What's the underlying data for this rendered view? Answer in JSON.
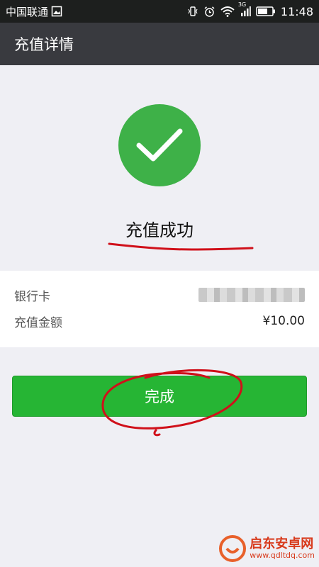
{
  "statusbar": {
    "carrier": "中国联通",
    "network_tag": "3G",
    "time": "11:48"
  },
  "header": {
    "title": "充值详情"
  },
  "result": {
    "status_text": "充值成功",
    "icon": "checkmark-icon",
    "accent_color": "#3eb148"
  },
  "details": {
    "bank_card_label": "银行卡",
    "amount_label": "充值金额",
    "amount_value": "¥10.00"
  },
  "actions": {
    "done_label": "完成",
    "button_color": "#26b534"
  },
  "watermark": {
    "name": "启东安卓网",
    "url": "www.qdltdq.com"
  },
  "annotation_color": "#d0101a"
}
